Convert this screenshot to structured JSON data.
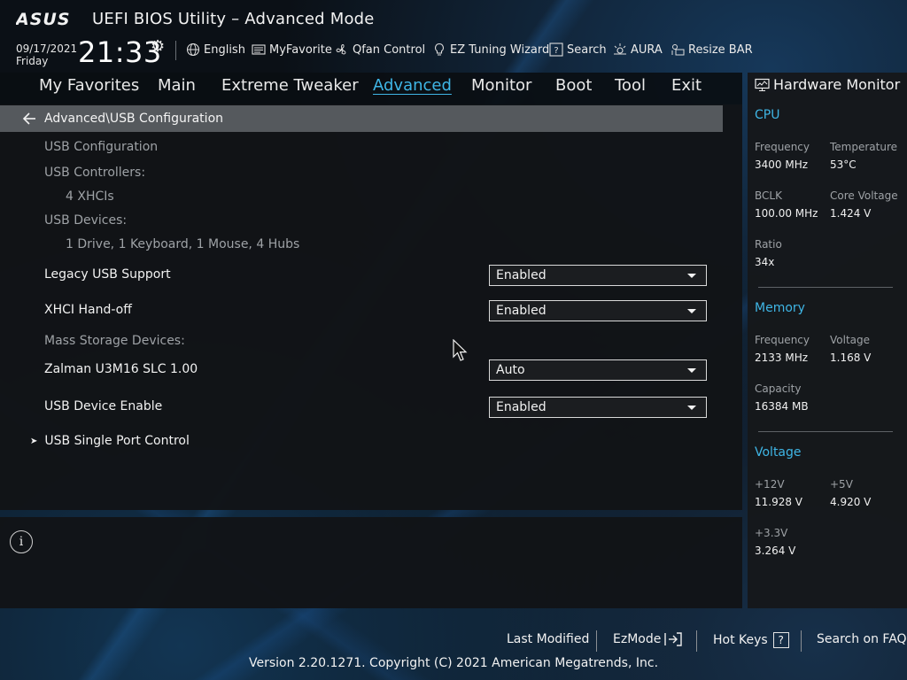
{
  "header": {
    "logo_text": "ASUS",
    "title": "UEFI BIOS Utility – Advanced Mode",
    "date": "09/17/2021",
    "day": "Friday",
    "time": "21:33"
  },
  "toolbar": [
    {
      "label": "English",
      "icon": "globe-icon"
    },
    {
      "label": "MyFavorite",
      "icon": "favorite-icon"
    },
    {
      "label": "Qfan Control",
      "icon": "fan-icon"
    },
    {
      "label": "EZ Tuning Wizard",
      "icon": "lightbulb-icon"
    },
    {
      "label": "Search",
      "icon": "help-search-icon"
    },
    {
      "label": "AURA",
      "icon": "aura-icon"
    },
    {
      "label": "Resize BAR",
      "icon": "resize-bar-icon"
    }
  ],
  "menu": {
    "items": [
      "My Favorites",
      "Main",
      "Extreme Tweaker",
      "Advanced",
      "Monitor",
      "Boot",
      "Tool",
      "Exit"
    ],
    "active": "Advanced"
  },
  "breadcrumb": "Advanced\\USB Configuration",
  "content": {
    "section_title": "USB Configuration",
    "controllers_label": "USB Controllers:",
    "controllers_value": "4 XHCIs",
    "devices_label": "USB Devices:",
    "devices_value": "1 Drive, 1 Keyboard, 1 Mouse, 4 Hubs",
    "legacy_label": "Legacy USB Support",
    "legacy_value": "Enabled",
    "xhci_label": "XHCI Hand-off",
    "xhci_value": "Enabled",
    "mass_storage_label": "Mass Storage Devices:",
    "zalman_label": "Zalman U3M16 SLC 1.00",
    "zalman_value": "Auto",
    "usb_enable_label": "USB Device Enable",
    "usb_enable_value": "Enabled",
    "single_port_label": "USB Single Port Control"
  },
  "hardware_monitor": {
    "title": "Hardware Monitor",
    "cpu": {
      "heading": "CPU",
      "frequency_label": "Frequency",
      "frequency": "3400 MHz",
      "temperature_label": "Temperature",
      "temperature": "53°C",
      "bclk_label": "BCLK",
      "bclk": "100.00 MHz",
      "core_voltage_label": "Core Voltage",
      "core_voltage": "1.424 V",
      "ratio_label": "Ratio",
      "ratio": "34x"
    },
    "memory": {
      "heading": "Memory",
      "frequency_label": "Frequency",
      "frequency": "2133 MHz",
      "voltage_label": "Voltage",
      "voltage": "1.168 V",
      "capacity_label": "Capacity",
      "capacity": "16384 MB"
    },
    "voltage": {
      "heading": "Voltage",
      "v12_label": "+12V",
      "v12": "11.928 V",
      "v5_label": "+5V",
      "v5": "4.920 V",
      "v33_label": "+3.3V",
      "v33": "3.264 V"
    }
  },
  "footer": {
    "last_modified": "Last Modified",
    "ezmode": "EzMode",
    "hotkeys": "Hot Keys",
    "hotkeys_key": "?",
    "faq": "Search on FAQ",
    "copyright": "Version 2.20.1271. Copyright (C) 2021 American Megatrends, Inc."
  },
  "colors": {
    "accent": "#3fb6e6",
    "breadcrumb_bg": "#55595d",
    "panel_bg": "#141619"
  }
}
